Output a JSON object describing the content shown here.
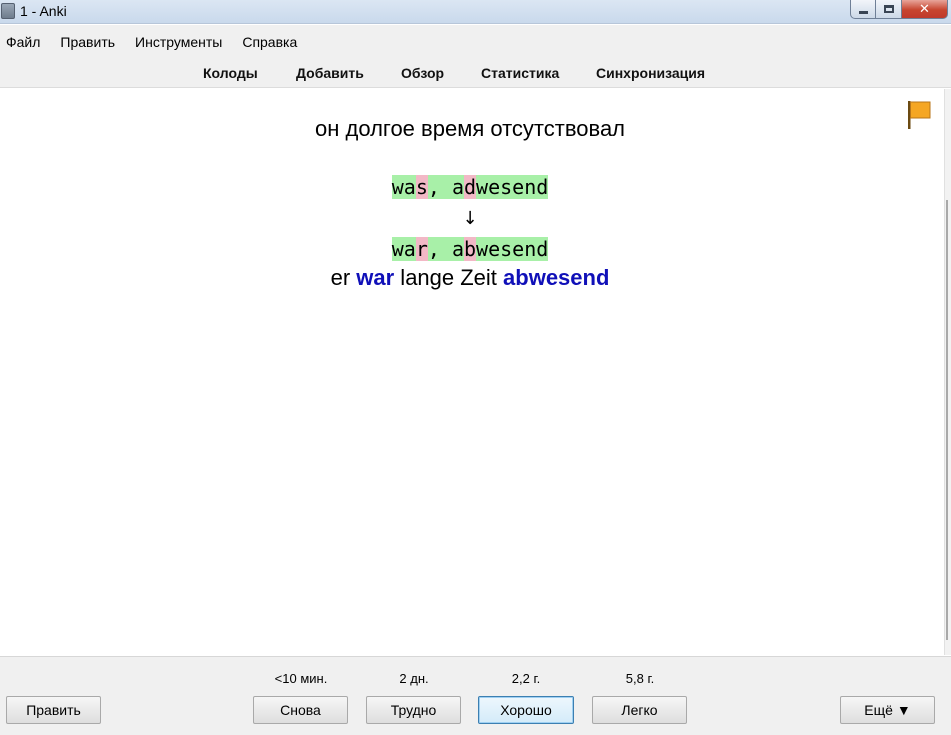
{
  "window": {
    "title": "1 - Anki",
    "close_glyph": "✕"
  },
  "menu": [
    "Файл",
    "Править",
    "Инструменты",
    "Справка"
  ],
  "toolbar": [
    "Колоды",
    "Добавить",
    "Обзор",
    "Статистика",
    "Синхронизация"
  ],
  "card": {
    "question": "он долгое время отсутствовал",
    "typed_segments": [
      {
        "text": "wa",
        "status": "good"
      },
      {
        "text": "s",
        "status": "bad"
      },
      {
        "text": ", a",
        "status": "good"
      },
      {
        "text": "d",
        "status": "bad"
      },
      {
        "text": "wesend",
        "status": "good"
      }
    ],
    "arrow": "↓",
    "correct_segments": [
      {
        "text": "wa",
        "status": "good"
      },
      {
        "text": "r",
        "status": "bad"
      },
      {
        "text": ", a",
        "status": "good"
      },
      {
        "text": "b",
        "status": "bad"
      },
      {
        "text": "wesend",
        "status": "good"
      }
    ],
    "answer_parts": [
      {
        "text": "er ",
        "highlight": false
      },
      {
        "text": "war",
        "highlight": true
      },
      {
        "text": " lange Zeit ",
        "highlight": false
      },
      {
        "text": "abwesend",
        "highlight": true
      }
    ],
    "flag_color": "#f5a623"
  },
  "bottom": {
    "edit_label": "Править",
    "more_label": "Ещё ▼",
    "intervals": [
      "<10 мин.",
      "2 дн.",
      "2,2 г.",
      "5,8 г."
    ],
    "answers": [
      "Снова",
      "Трудно",
      "Хорошо",
      "Легко"
    ]
  }
}
